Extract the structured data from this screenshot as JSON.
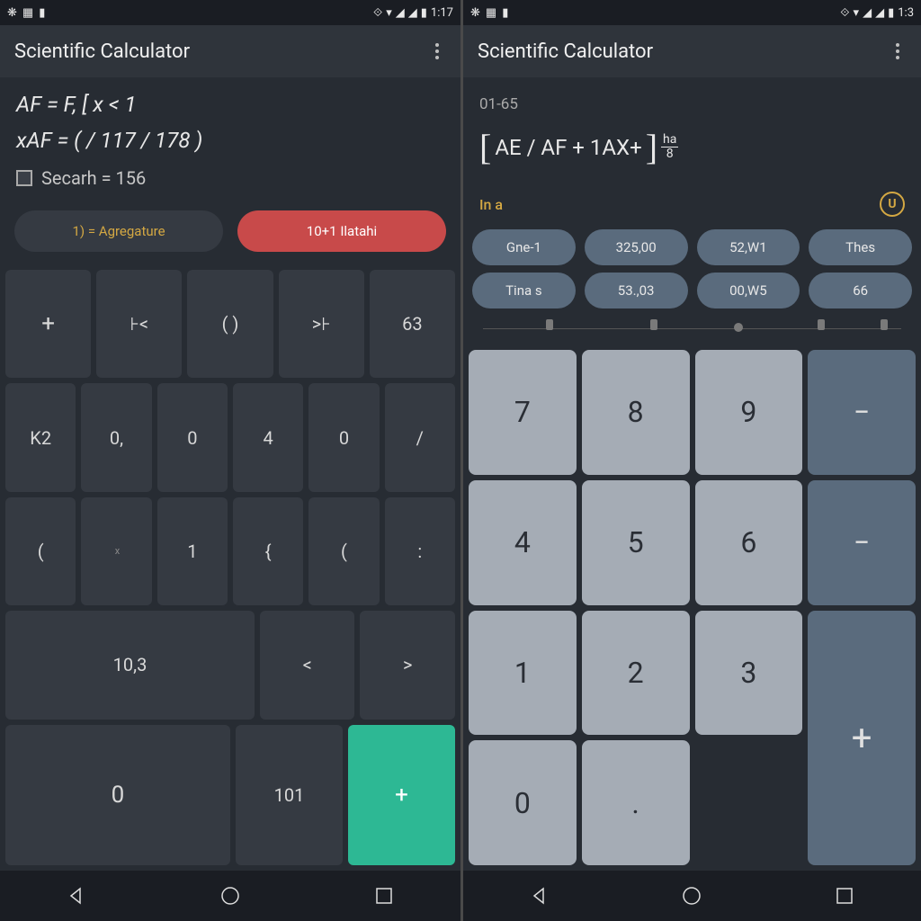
{
  "left": {
    "status": {
      "time": "1:17",
      "icons": [
        "settings",
        "grid",
        "card"
      ]
    },
    "title": "Scientific Calculator",
    "display": {
      "line1": "AF = F, [ x < 1",
      "line2": "xAF = ( / 117 / 178 )",
      "result_label": "Secarh = 156"
    },
    "pills": {
      "left": "1) = Agregature",
      "right": "10+1 Ilatahi"
    },
    "keys": {
      "r1": [
        "+",
        "⊦<",
        "( )",
        ">⊦",
        "63"
      ],
      "r2": [
        "K2",
        "0,",
        "0",
        "4",
        "0",
        "/"
      ],
      "r3": [
        "(",
        "x",
        "1",
        "{",
        "(",
        ":"
      ],
      "r4": [
        "10,3",
        "<",
        ">"
      ],
      "r5": [
        "0",
        "101",
        "+"
      ]
    }
  },
  "right": {
    "status": {
      "time": "1:3",
      "icons": [
        "settings",
        "grid",
        "card"
      ]
    },
    "title": "Scientific Calculator",
    "display": {
      "small": "01-65",
      "main_bracket_left": "[",
      "main_inner": "AE / AF + 1AX+",
      "main_bracket_right": "]",
      "frac_top": "ha",
      "frac_bot": "8"
    },
    "mode": {
      "label": "In a",
      "undo": "U"
    },
    "chips": {
      "r1": [
        "Gne-1",
        "325,00",
        "52,W1",
        "Thes"
      ],
      "r2": [
        "Tina s",
        "53.,03",
        "00,W5",
        "66"
      ]
    },
    "numpad": {
      "k7": "7",
      "k8": "8",
      "k9": "9",
      "minus1": "−",
      "k4": "4",
      "k5": "5",
      "k6": "6",
      "minus2": "−",
      "k1": "1",
      "k2": "2",
      "k3": "3",
      "k0": "0",
      "kdot": ".",
      "plus": "+"
    }
  }
}
